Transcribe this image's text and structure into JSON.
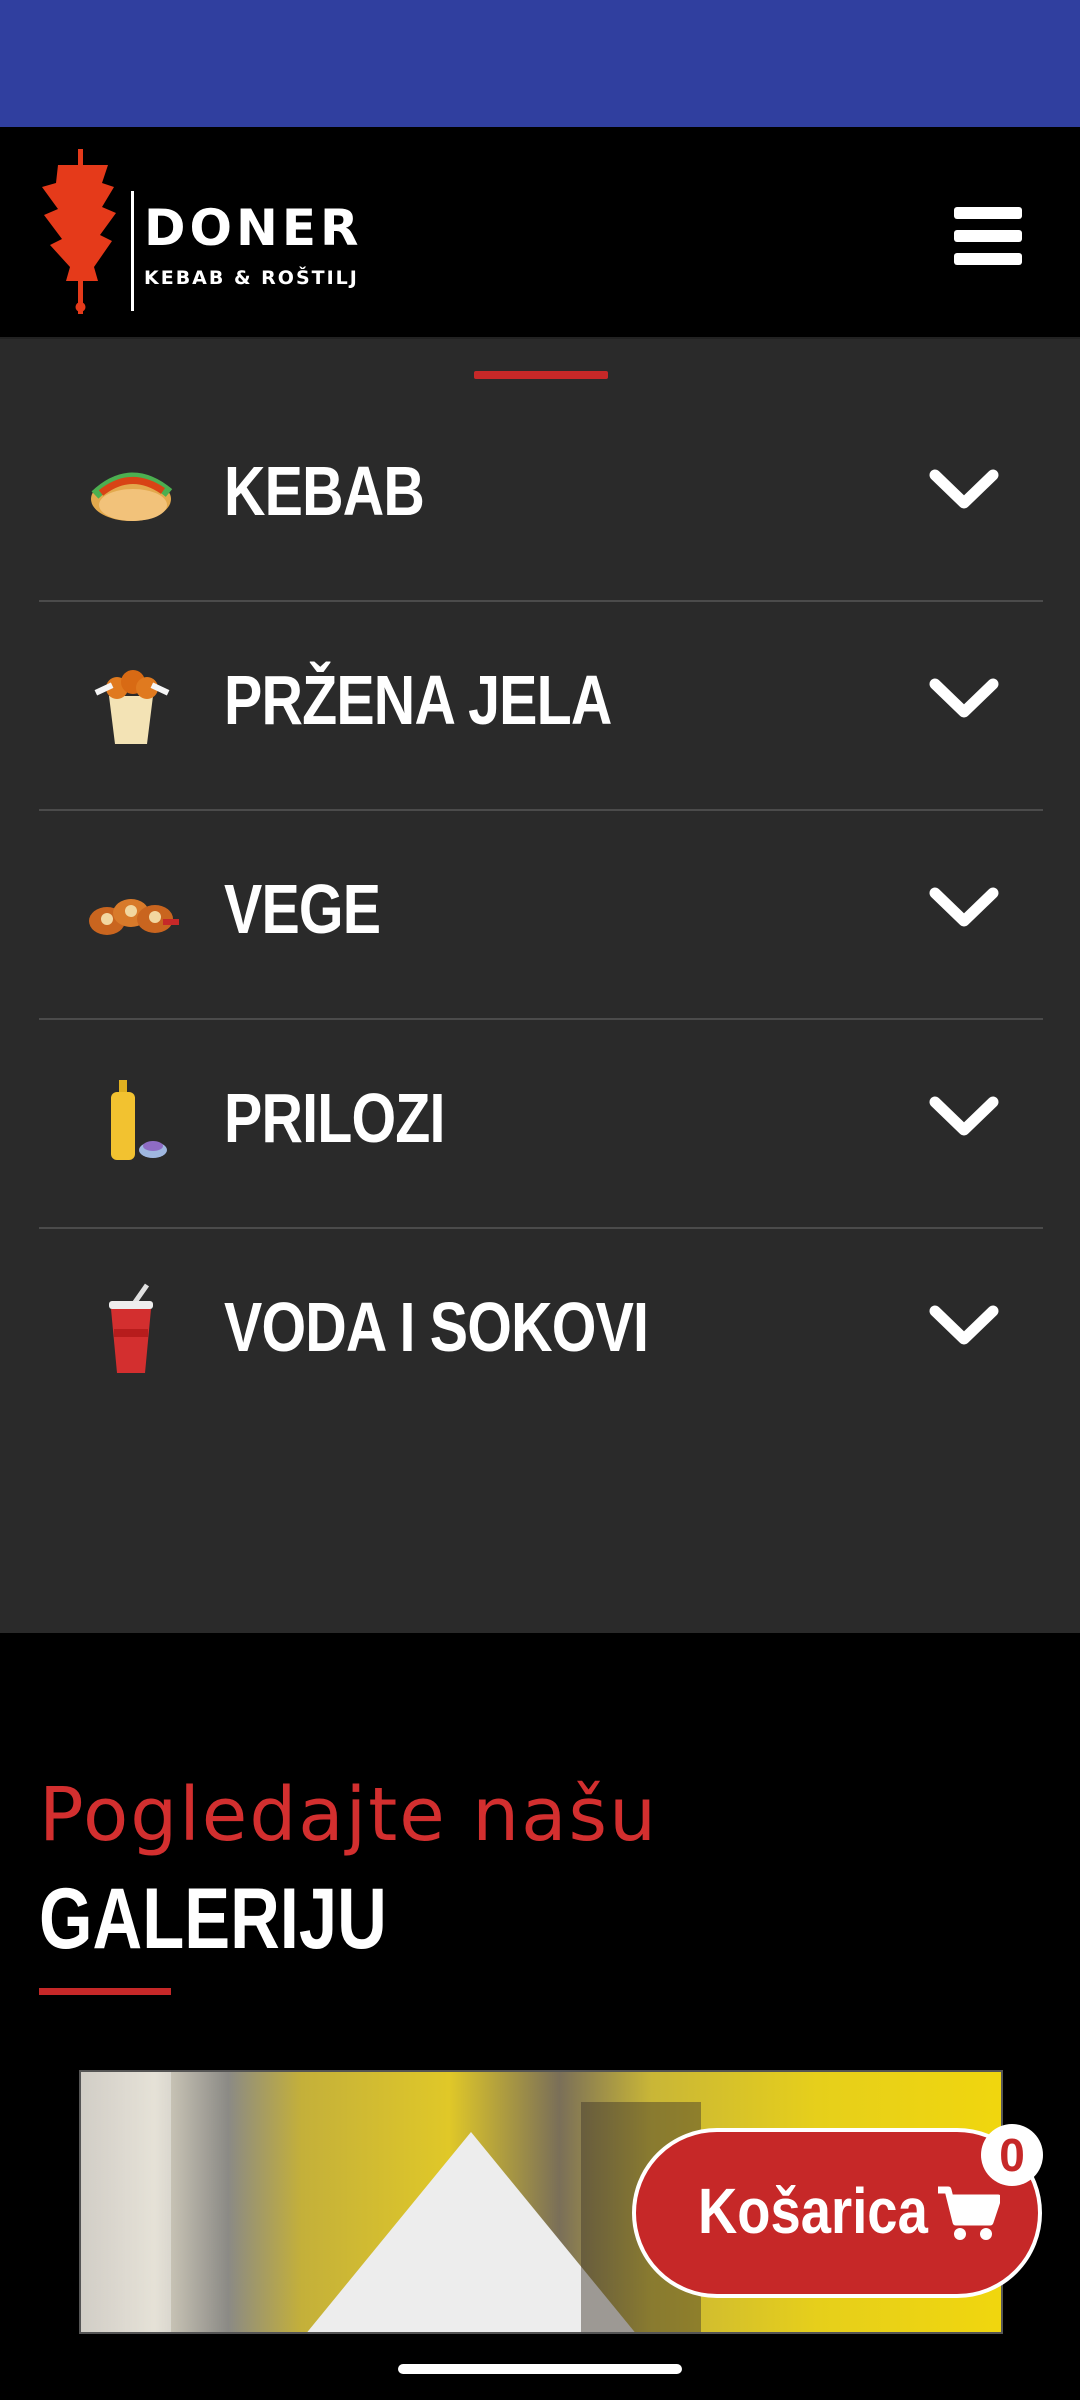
{
  "header": {
    "logo_title": "DONER",
    "logo_subtitle": "KEBAB & ROŠTILJ",
    "menu_icon": "hamburger-menu-icon"
  },
  "menu": {
    "categories": [
      {
        "label": "KEBAB",
        "icon": "taco-icon"
      },
      {
        "label": "PRŽENA JELA",
        "icon": "fries-bucket-icon"
      },
      {
        "label": "VEGE",
        "icon": "veggie-rolls-icon"
      },
      {
        "label": "PRILOZI",
        "icon": "sauce-bottle-icon"
      },
      {
        "label": "VODA I SOKOVI",
        "icon": "drink-cup-icon"
      }
    ]
  },
  "gallery": {
    "title_top": "Pogledajte našu",
    "title_bottom": "GALERIJU"
  },
  "cart": {
    "label": "Košarica",
    "count": "0",
    "icon": "shopping-cart-icon"
  },
  "colors": {
    "status_bar": "#303f9f",
    "accent_red": "#c62828",
    "menu_bg": "#2a2a2a"
  }
}
